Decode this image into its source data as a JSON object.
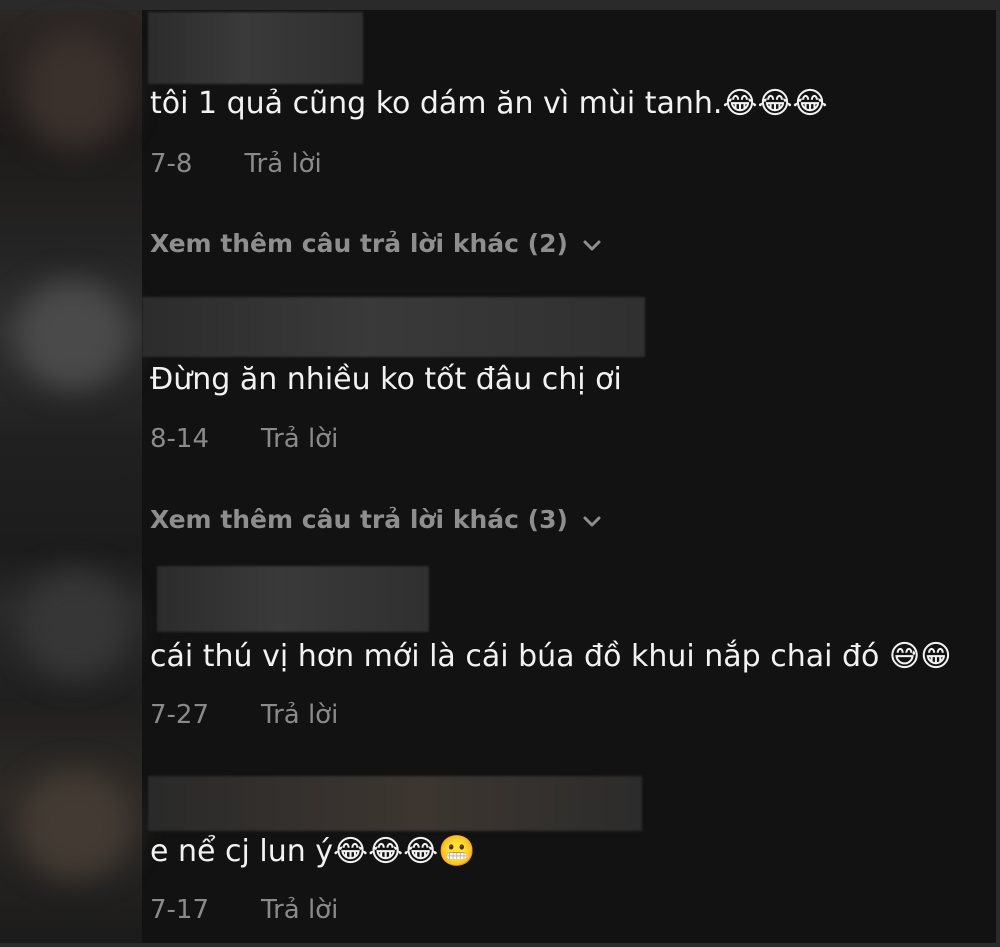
{
  "comments": [
    {
      "text": "tôi 1 quả cũng ko dám ăn vì mùi tanh.😂😂😂",
      "date": "7-8",
      "reply": "Trả lời"
    },
    {
      "text": "Đừng ăn nhiều ko tốt đâu chị ơi",
      "date": "8-14",
      "reply": "Trả lời"
    },
    {
      "text": "cái thú vị hơn mới là cái búa đồ khui nắp chai đó 😅😁",
      "date": "7-27",
      "reply": "Trả lời"
    },
    {
      "text": "e nể cj lun ý😂😂😂😬",
      "date": "7-17",
      "reply": "Trả lời"
    }
  ],
  "more_replies": [
    {
      "label": "Xem thêm câu trả lời khác (2)"
    },
    {
      "label": "Xem thêm câu trả lời khác (3)"
    }
  ],
  "icons": {
    "expand": "chevron-down-icon"
  },
  "colors": {
    "background": "#121212",
    "text": "#f2f2f2",
    "meta": "#8a8a8a"
  }
}
